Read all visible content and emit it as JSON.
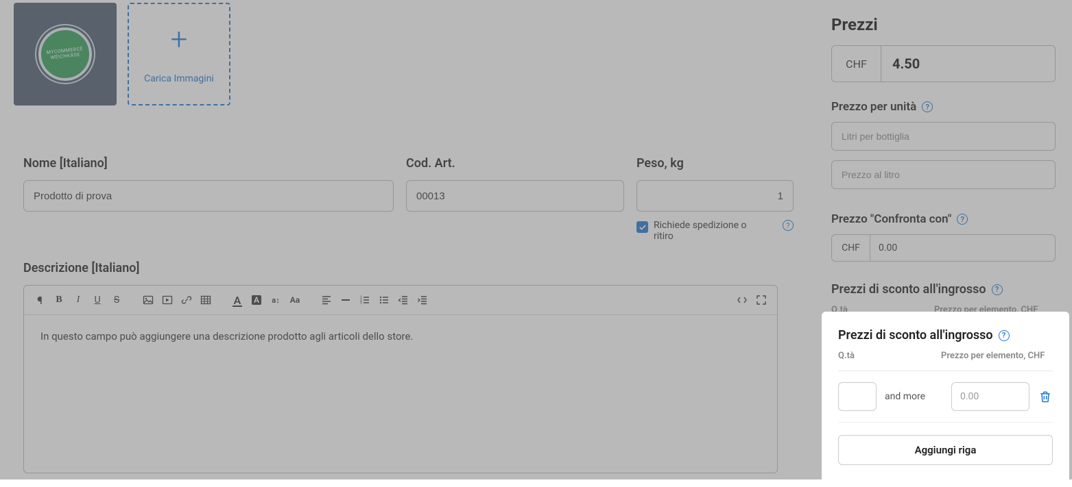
{
  "images": {
    "upload_label": "Carica Immagini"
  },
  "fields": {
    "name_label": "Nome [Italiano]",
    "name_value": "Prodotto di prova",
    "sku_label": "Cod. Art.",
    "sku_value": "00013",
    "weight_label": "Peso, kg",
    "weight_value": "1",
    "requires_shipping_label": "Richiede spedizione o ritiro",
    "requires_shipping_checked": true,
    "description_label": "Descrizione [Italiano]",
    "description_value": "In questo campo può aggiungere una descrizione prodotto agli articoli dello store."
  },
  "prices": {
    "heading": "Prezzi",
    "currency": "CHF",
    "price_value": "4.50",
    "per_unit_heading": "Prezzo per unità",
    "per_unit_placeholder_1": "Litri per bottiglia",
    "per_unit_placeholder_2": "Prezzo al litro",
    "compare_heading": "Prezzo \"Confronta con\"",
    "compare_value": "0.00"
  },
  "wholesale": {
    "heading": "Prezzi di sconto all'ingrosso",
    "col_qty": "Q.tà",
    "col_price": "Prezzo per elemento, CHF",
    "and_more": "and more",
    "price_placeholder": "0.00",
    "add_row_label": "Aggiungi riga"
  }
}
